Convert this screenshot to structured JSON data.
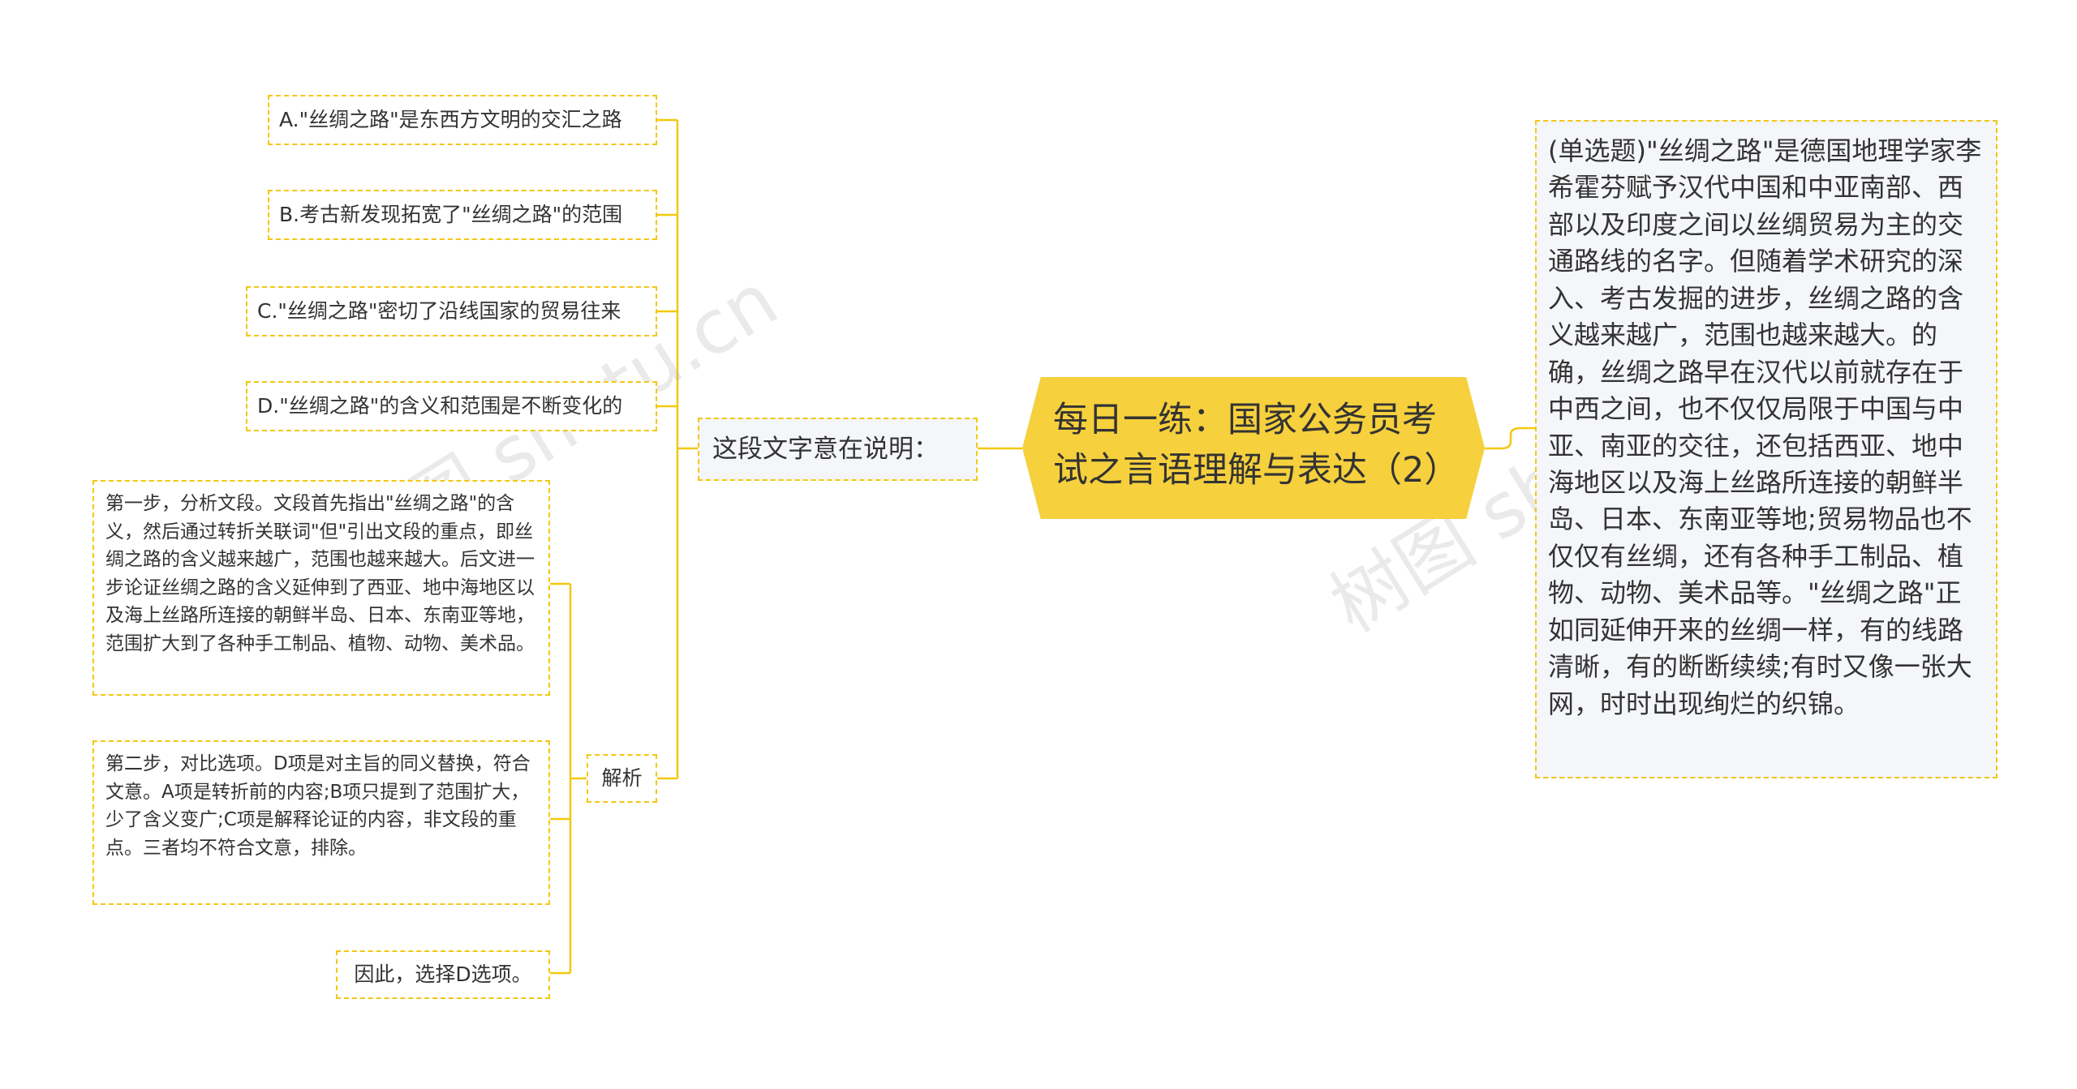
{
  "central_topic": "每日一练：国家公务员考试之言语理解与表达（2）",
  "question": "(单选题)\"丝绸之路\"是德国地理学家李希霍芬赋予汉代中国和中亚南部、西部以及印度之间以丝绸贸易为主的交通路线的名字。但随着学术研究的深入、考古发掘的进步，丝绸之路的含义越来越广，范围也越来越大。的确，丝绸之路早在汉代以前就存在于中西之间，也不仅仅局限于中国与中亚、南亚的交往，还包括西亚、地中海地区以及海上丝路所连接的朝鲜半岛、日本、东南亚等地;贸易物品也不仅仅有丝绸，还有各种手工制品、植物、动物、美术品等。\"丝绸之路\"正如同延伸开来的丝绸一样，有的线路清晰，有的断断续续;有时又像一张大网，时时出现绚烂的织锦。",
  "prompt_node": "这段文字意在说明：",
  "options": [
    "A.\"丝绸之路\"是东西方文明的交汇之路",
    "B.考古新发现拓宽了\"丝绸之路\"的范围",
    "C.\"丝绸之路\"密切了沿线国家的贸易往来",
    "D.\"丝绸之路\"的含义和范围是不断变化的"
  ],
  "analysis": {
    "label": "解析",
    "step1": "第一步，分析文段。文段首先指出\"丝绸之路\"的含义，然后通过转折关联词\"但\"引出文段的重点，即丝绸之路的含义越来越广，范围也越来越大。后文进一步论证丝绸之路的含义延伸到了西亚、地中海地区以及海上丝路所连接的朝鲜半岛、日本、东南亚等地，范围扩大到了各种手工制品、植物、动物、美术品。",
    "step2": "第二步，对比选项。D项是对主旨的同义替换，符合文意。A项是转折前的内容;B项只提到了范围扩大，少了含义变广;C项是解释论证的内容，非文段的重点。三者均不符合文意，排除。",
    "conclusion": "因此，选择D选项。"
  },
  "watermarks": [
    "树图 shutu.cn",
    "树图 shutu.cn"
  ],
  "colors": {
    "accent": "#f2c811",
    "central_fill": "#f6d03d",
    "node_fill_light": "#f4f6f9",
    "text": "#333333"
  }
}
